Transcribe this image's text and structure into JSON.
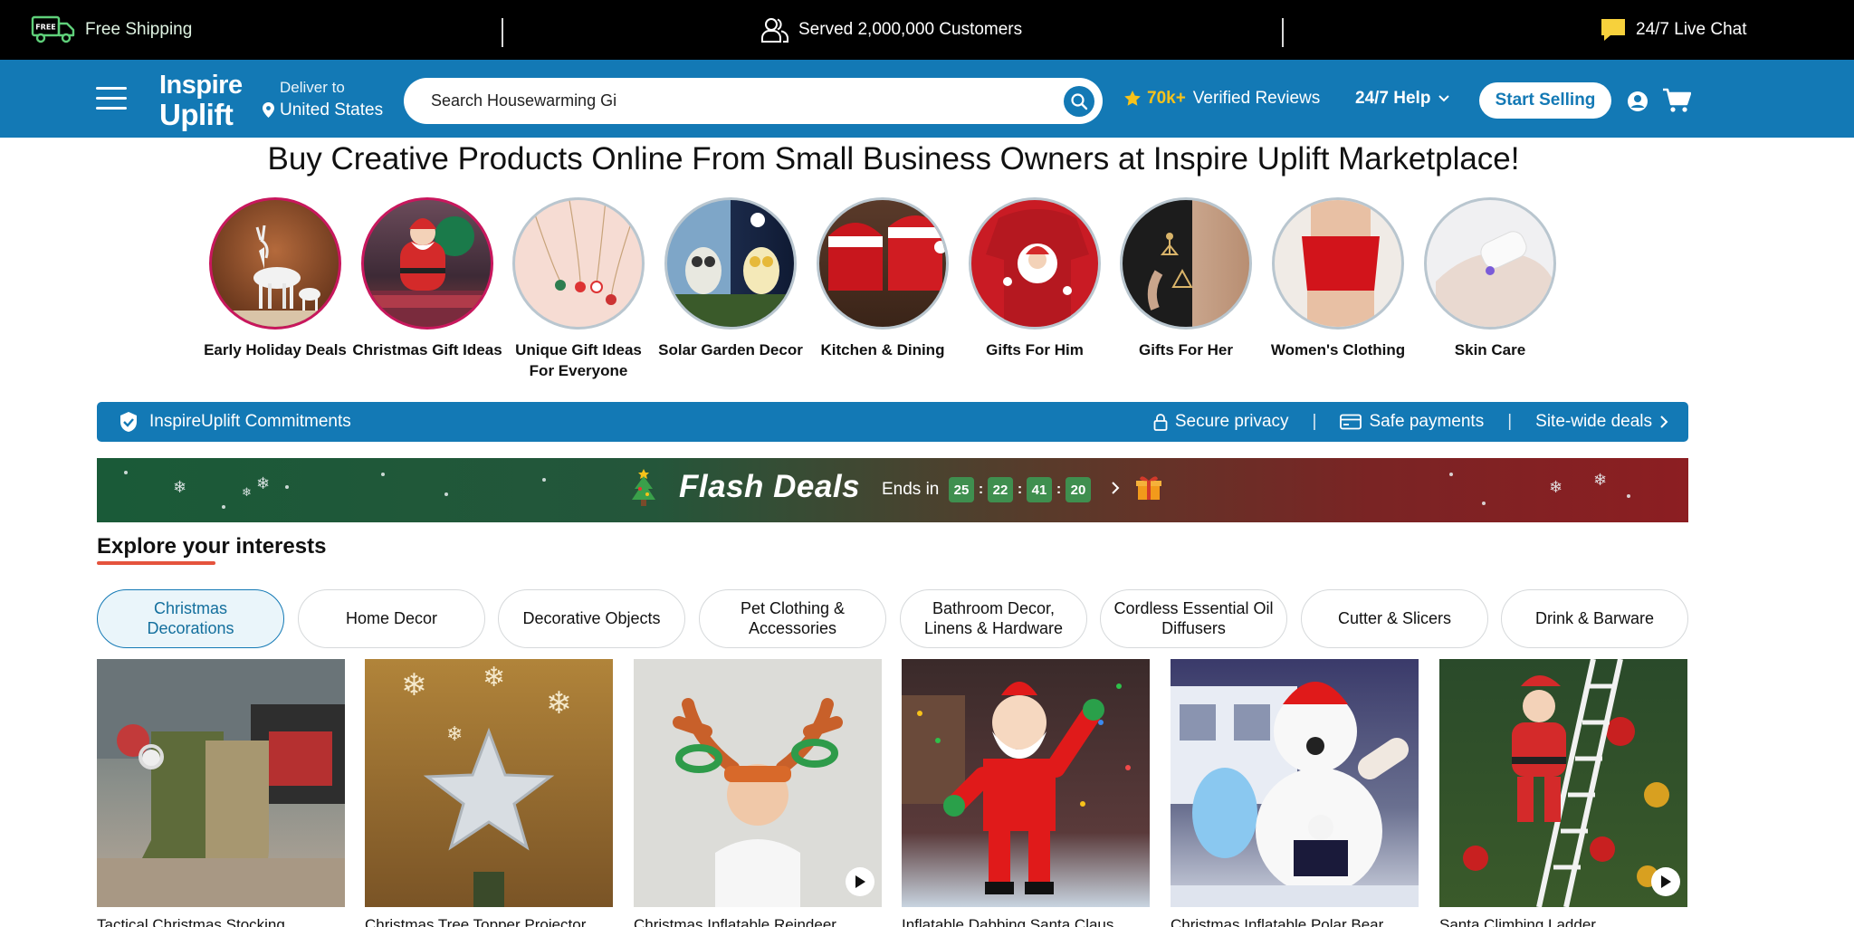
{
  "topbar": {
    "shipping": "Free Shipping",
    "shipping_badge": "FREE",
    "customers": "Served 2,000,000 Customers",
    "chat": "24/7 Live Chat"
  },
  "header": {
    "logo_line1": "Inspire",
    "logo_line2": "Uplift",
    "deliver_label": "Deliver to",
    "deliver_country": "United States",
    "search_value": "Search Housewarming Gi",
    "reviews_count": "70k+",
    "reviews_label": "Verified Reviews",
    "help_label": "24/7 Help",
    "start_selling": "Start Selling"
  },
  "headline": "Buy Creative Products Online From Small Business Owners at Inspire Uplift Marketplace!",
  "categories": [
    {
      "label": "Early Holiday Deals"
    },
    {
      "label": "Christmas Gift Ideas"
    },
    {
      "label": "Unique Gift Ideas For Everyone"
    },
    {
      "label": "Solar Garden Decor"
    },
    {
      "label": "Kitchen & Dining"
    },
    {
      "label": "Gifts For Him"
    },
    {
      "label": "Gifts For Her"
    },
    {
      "label": "Women's Clothing"
    },
    {
      "label": "Skin Care"
    }
  ],
  "commitments": {
    "title": "InspireUplift Commitments",
    "secure": "Secure privacy",
    "payments": "Safe payments",
    "deals": "Site-wide deals",
    "separator": "|"
  },
  "flash": {
    "title": "Flash Deals",
    "ends_in": "Ends in",
    "timer": [
      "25",
      "22",
      "41",
      "20"
    ]
  },
  "explore": {
    "title": "Explore your interests",
    "pills": [
      "Christmas Decorations",
      "Home Decor",
      "Decorative Objects",
      "Pet Clothing & Accessories",
      "Bathroom Decor, Linens & Hardware",
      "Cordless Essential Oil Diffusers",
      "Cutter & Slicers",
      "Drink & Barware"
    ]
  },
  "products": [
    {
      "name": "Tactical Christmas Stocking"
    },
    {
      "name": "Christmas Tree Topper Projector"
    },
    {
      "name": "Christmas Inflatable Reindeer"
    },
    {
      "name": "Inflatable Dabbing Santa Claus"
    },
    {
      "name": "Christmas Inflatable Polar Bear"
    },
    {
      "name": "Santa Climbing Ladder"
    }
  ],
  "colors": {
    "brand_blue": "#1379b5",
    "accent_yellow": "#f7c21a",
    "underline_red": "#e5533d",
    "timer_green": "#3f8f4f"
  }
}
